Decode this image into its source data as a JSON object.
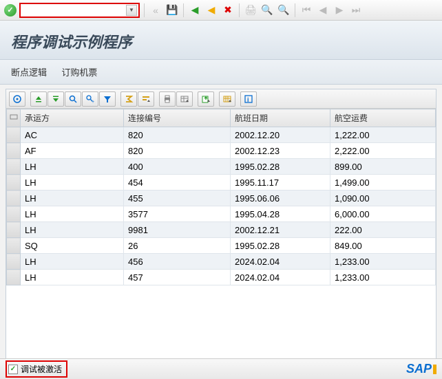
{
  "title": "程序调试示例程序",
  "links": {
    "breakpoint_logic": "断点逻辑",
    "book_flight": "订购机票"
  },
  "table": {
    "headers": {
      "carrier": "承运方",
      "connid": "连接编号",
      "fldate": "航班日期",
      "fare": "航空运费"
    },
    "rows": [
      {
        "carrier": "AC",
        "connid": "820",
        "fldate": "2002.12.20",
        "fare": "1,222.00"
      },
      {
        "carrier": "AF",
        "connid": "820",
        "fldate": "2002.12.23",
        "fare": "2,222.00"
      },
      {
        "carrier": "LH",
        "connid": "400",
        "fldate": "1995.02.28",
        "fare": "899.00"
      },
      {
        "carrier": "LH",
        "connid": "454",
        "fldate": "1995.11.17",
        "fare": "1,499.00"
      },
      {
        "carrier": "LH",
        "connid": "455",
        "fldate": "1995.06.06",
        "fare": "1,090.00"
      },
      {
        "carrier": "LH",
        "connid": "3577",
        "fldate": "1995.04.28",
        "fare": "6,000.00"
      },
      {
        "carrier": "LH",
        "connid": "9981",
        "fldate": "2002.12.21",
        "fare": "222.00"
      },
      {
        "carrier": "SQ",
        "connid": "26",
        "fldate": "1995.02.28",
        "fare": "849.00"
      },
      {
        "carrier": "LH",
        "connid": "456",
        "fldate": "2024.02.04",
        "fare": "1,233.00"
      },
      {
        "carrier": "LH",
        "connid": "457",
        "fldate": "2024.02.04",
        "fare": "1,233.00"
      }
    ]
  },
  "status": {
    "debug_active": "调试被激活"
  },
  "colors": {
    "highlight_border": "#d00",
    "sap_blue": "#0a6ed1",
    "sap_gold": "#f0ab00"
  }
}
